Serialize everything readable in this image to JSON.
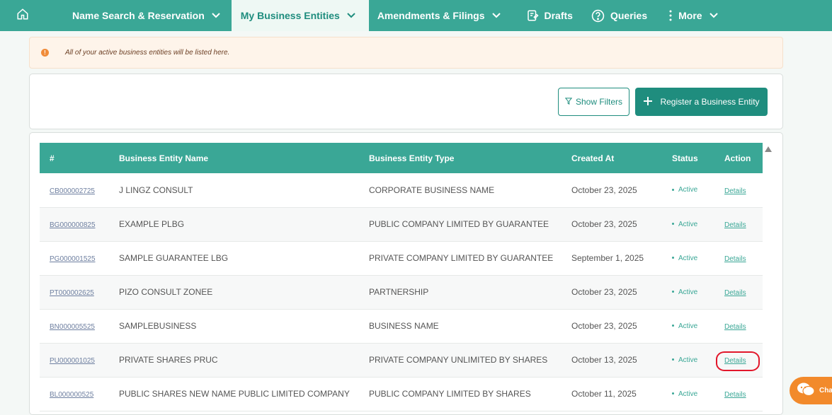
{
  "nav": {
    "items": [
      {
        "label": "Name Search & Reservation"
      },
      {
        "label": "My Business Entities"
      },
      {
        "label": "Amendments & Filings"
      },
      {
        "label": "Drafts"
      },
      {
        "label": "Queries"
      },
      {
        "label": "More"
      }
    ]
  },
  "alert": {
    "text": "All of your active business entities will be listed here."
  },
  "actions": {
    "filters_label": "Show Filters",
    "register_label": "Register a Business Entity"
  },
  "table": {
    "headers": [
      "#",
      "Business Entity Name",
      "Business Entity Type",
      "Created At",
      "Status",
      "Action"
    ],
    "rows": [
      {
        "id": "CB000002725",
        "name": "J LINGZ CONSULT",
        "type": "CORPORATE BUSINESS NAME",
        "created": "October 23, 2025",
        "status": "Active",
        "action": "Details"
      },
      {
        "id": "BG000000825",
        "name": "EXAMPLE PLBG",
        "type": "PUBLIC COMPANY LIMITED BY GUARANTEE",
        "created": "October 23, 2025",
        "status": "Active",
        "action": "Details"
      },
      {
        "id": "PG000001525",
        "name": "SAMPLE GUARANTEE LBG",
        "type": "PRIVATE COMPANY LIMITED BY GUARANTEE",
        "created": "September 1, 2025",
        "status": "Active",
        "action": "Details"
      },
      {
        "id": "PT000002625",
        "name": "PIZO CONSULT ZONEE",
        "type": "PARTNERSHIP",
        "created": "October 23, 2025",
        "status": "Active",
        "action": "Details"
      },
      {
        "id": "BN000005525",
        "name": "SAMPLEBUSINESS",
        "type": "BUSINESS NAME",
        "created": "October 23, 2025",
        "status": "Active",
        "action": "Details"
      },
      {
        "id": "PU000001025",
        "name": "PRIVATE SHARES PRUC",
        "type": "PRIVATE COMPANY UNLIMITED BY SHARES",
        "created": "October 13, 2025",
        "status": "Active",
        "action": "Details"
      },
      {
        "id": "BL000000525",
        "name": "PUBLIC SHARES NEW NAME PUBLIC LIMITED COMPANY",
        "type": "PUBLIC COMPANY LIMITED BY SHARES",
        "created": "October 11, 2025",
        "status": "Active",
        "action": "Details"
      }
    ]
  },
  "chat": {
    "label": "Cha"
  },
  "colors": {
    "primary": "#3aa796",
    "primary_dark": "#1f8d7e",
    "alert_bg": "#fef4ea",
    "highlight": "#e2162a",
    "chat": "#f28a2b"
  }
}
